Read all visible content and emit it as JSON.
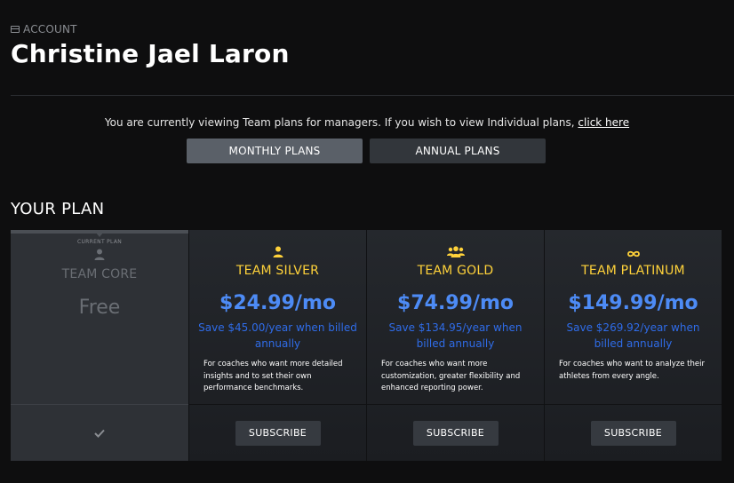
{
  "header": {
    "section_label": "ACCOUNT",
    "user_name": "Christine Jael Laron"
  },
  "notice": {
    "text": "You are currently viewing Team plans for managers. If you wish to view Individual plans, ",
    "link_text": "click here"
  },
  "toggle": {
    "monthly_label": "MONTHLY PLANS",
    "annual_label": "ANNUAL PLANS",
    "selected": "monthly"
  },
  "section_title": "YOUR PLAN",
  "plans": [
    {
      "current_label": "CURRENT PLAN",
      "icon": "user-icon",
      "name": "TEAM CORE",
      "price": "Free",
      "savings": "",
      "description": "",
      "action": "checkmark-icon"
    },
    {
      "icon": "user-icon",
      "name": "TEAM SILVER",
      "price": "$24.99/mo",
      "savings": "Save $45.00/year when billed annually",
      "description": "For coaches who want more detailed insights and to set their own performance benchmarks.",
      "action_label": "SUBSCRIBE"
    },
    {
      "icon": "users-group-icon",
      "name": "TEAM GOLD",
      "price": "$74.99/mo",
      "savings": "Save $134.95/year when billed annually",
      "description": "For coaches who want more customization, greater flexibility and enhanced reporting power.",
      "action_label": "SUBSCRIBE"
    },
    {
      "icon": "infinity-icon",
      "name": "TEAM PLATINUM",
      "price": "$149.99/mo",
      "savings": "Save $269.92/year when billed annually",
      "description": "For coaches who want to analyze their athletes from every angle.",
      "action_label": "SUBSCRIBE"
    }
  ],
  "colors": {
    "background": "#0e0e0f",
    "accent_gold": "#ffd23a",
    "price_blue": "#4d8bf5",
    "savings_blue": "#2f6ce8"
  }
}
